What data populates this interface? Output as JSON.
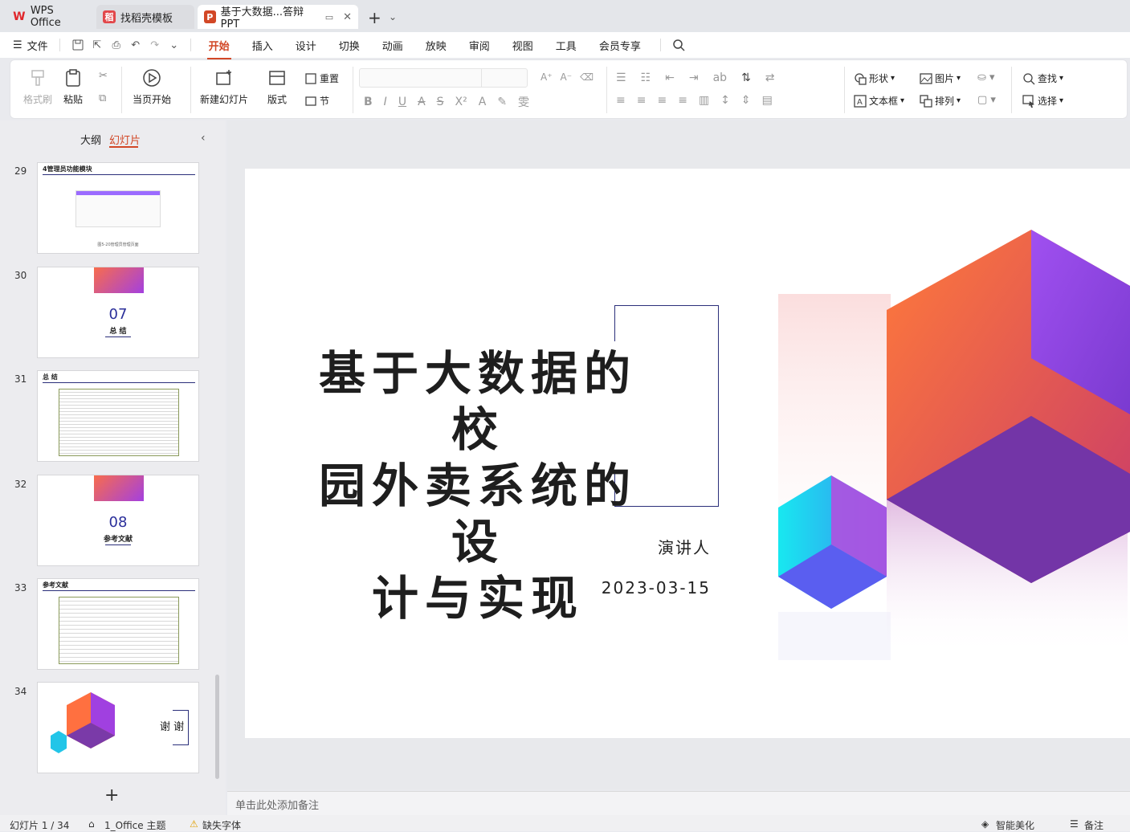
{
  "tabs": {
    "wps": "WPS Office",
    "template": "找稻壳模板",
    "doc": "基于大数据...答辩PPT"
  },
  "menu": {
    "file": "文件",
    "items": [
      "开始",
      "插入",
      "设计",
      "切换",
      "动画",
      "放映",
      "审阅",
      "视图",
      "工具",
      "会员专享"
    ],
    "active": "开始"
  },
  "ribbon": {
    "format_painter": "格式刷",
    "paste": "粘贴",
    "from_current": "当页开始",
    "new_slide": "新建幻灯片",
    "layout": "版式",
    "reset": "重置",
    "section": "节",
    "shape": "形状",
    "picture": "图片",
    "textbox": "文本框",
    "arrange": "排列",
    "find": "查找",
    "select": "选择"
  },
  "panel": {
    "outline": "大纲",
    "slides": "幻灯片",
    "add": "+"
  },
  "thumbs": [
    {
      "num": "29",
      "title": "4管理员功能模块",
      "caption": "图5-20管理员管理页面"
    },
    {
      "num": "30",
      "big": "07",
      "sub": "总 结"
    },
    {
      "num": "31",
      "title": "总 结"
    },
    {
      "num": "32",
      "big": "08",
      "sub": "参考文献"
    },
    {
      "num": "33",
      "title": "参考文献"
    },
    {
      "num": "34",
      "thanks": "谢 谢"
    }
  ],
  "slide": {
    "title_lines": [
      "基于大数据的校",
      "园外卖系统的设",
      "计与实现"
    ],
    "presenter": "演讲人",
    "date": "2023-03-15"
  },
  "notes": {
    "placeholder": "单击此处添加备注"
  },
  "status": {
    "slide_count": "幻灯片 1 / 34",
    "theme": "1_Office 主题",
    "missing_font": "缺失字体",
    "beautify": "智能美化",
    "notes": "备注"
  },
  "colors": {
    "accent": "#d24726",
    "navy": "#2b2f7a"
  }
}
